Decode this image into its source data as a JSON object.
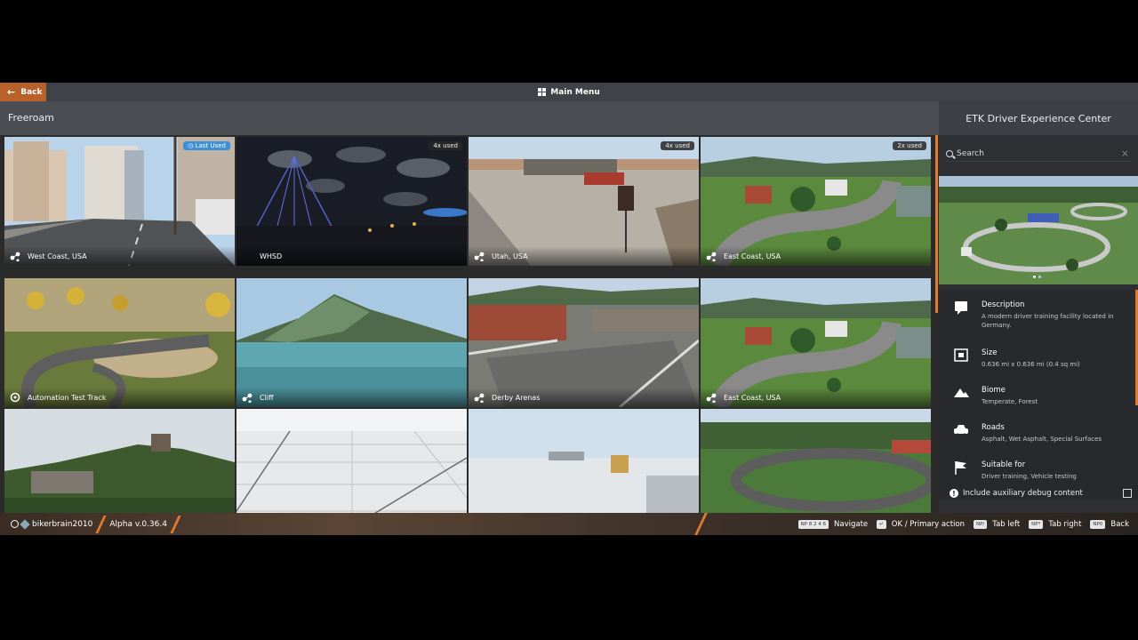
{
  "topbar": {
    "back_label": "Back",
    "main_menu_label": "Main Menu"
  },
  "section": {
    "title": "Freeroam"
  },
  "tiles": [
    {
      "label": "West Coast, USA",
      "badge": "Last Used",
      "icon": "map-pin-icon"
    },
    {
      "label": "WHSD",
      "badge": "4x used",
      "icon": ""
    },
    {
      "label": "Utah, USA",
      "badge": "4x used",
      "icon": "map-pin-icon"
    },
    {
      "label": "East Coast, USA",
      "badge": "2x used",
      "icon": "map-pin-icon"
    },
    {
      "label": "Automation Test Track",
      "badge": "",
      "icon": "automation-icon"
    },
    {
      "label": "Cliff",
      "badge": "",
      "icon": "map-pin-icon"
    },
    {
      "label": "Derby Arenas",
      "badge": "",
      "icon": "map-pin-icon"
    },
    {
      "label": "East Coast, USA",
      "badge": "",
      "icon": "map-pin-icon"
    },
    {
      "label": "",
      "badge": "",
      "icon": ""
    },
    {
      "label": "",
      "badge": "",
      "icon": ""
    },
    {
      "label": "",
      "badge": "",
      "icon": ""
    },
    {
      "label": "",
      "badge": "",
      "icon": ""
    }
  ],
  "panel": {
    "title": "ETK Driver Experience Center",
    "search_placeholder": "Search",
    "rows": [
      {
        "heading": "Description",
        "text": "A modern driver training facility located in Germany.",
        "icon": "comment-icon"
      },
      {
        "heading": "Size",
        "text": "0.636 mi x 0.636 mi (0.4 sq mi)",
        "icon": "size-icon"
      },
      {
        "heading": "Biome",
        "text": "Temperate, Forest",
        "icon": "mountain-icon"
      },
      {
        "heading": "Roads",
        "text": "Asphalt, Wet Asphalt, Special Surfaces",
        "icon": "car-icon"
      },
      {
        "heading": "Suitable for",
        "text": "Driver training, Vehicle testing",
        "icon": "flag-icon"
      }
    ],
    "debug_label": "Include auxiliary debug content"
  },
  "bottombar": {
    "username": "bikerbrain2010",
    "version": "Alpha v.0.36.4",
    "hints": [
      {
        "keys": "NP 8 2 4 6",
        "label": "Navigate"
      },
      {
        "keys": "↵",
        "label": "OK / Primary action"
      },
      {
        "keys": "NP/",
        "label": "Tab left"
      },
      {
        "keys": "NP*",
        "label": "Tab right"
      },
      {
        "keys": "NP0",
        "label": "Back"
      }
    ]
  },
  "colors": {
    "accent": "#e07a2c",
    "back_button": "#b8612b",
    "badge_last_used": "#3d8fd8"
  }
}
